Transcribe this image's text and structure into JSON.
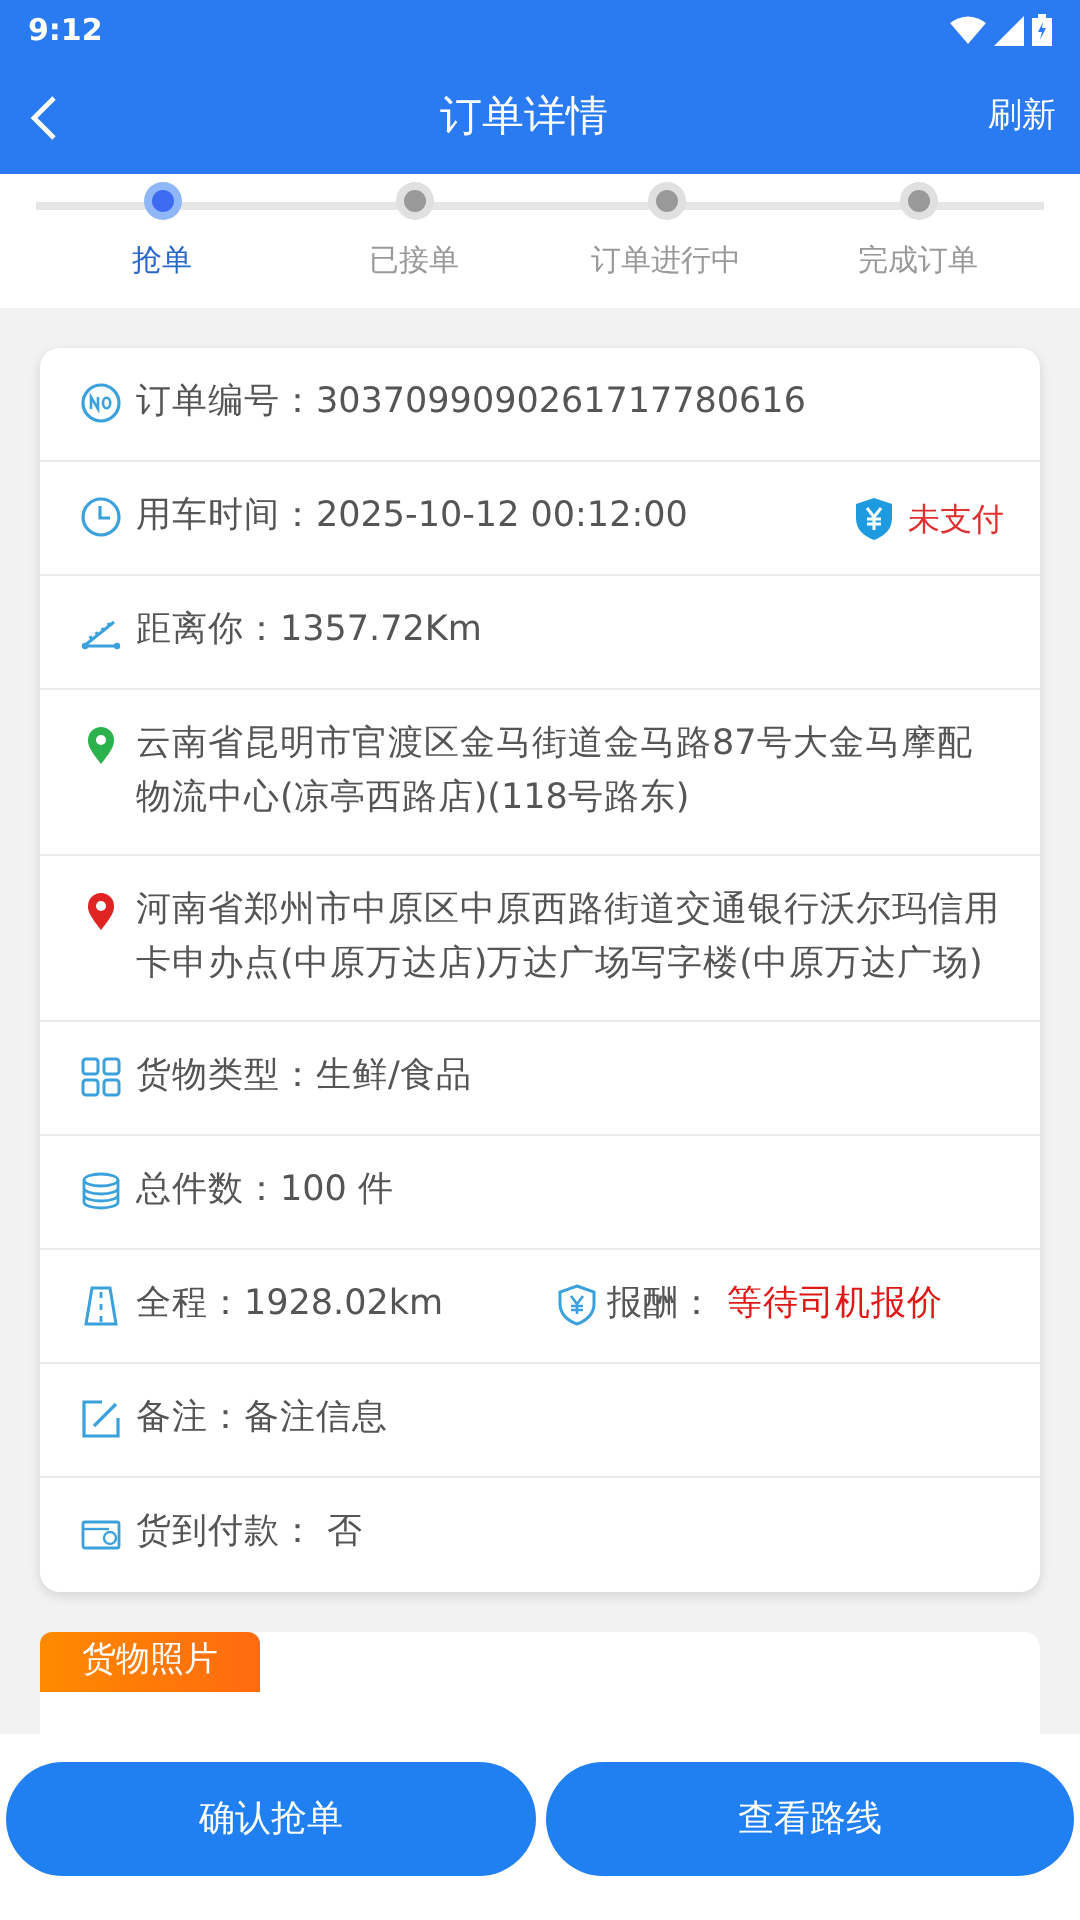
{
  "status_bar": {
    "time": "9:12"
  },
  "header": {
    "title": "订单详情",
    "action": "刷新"
  },
  "steps": [
    {
      "label": "抢单",
      "selected": true
    },
    {
      "label": "已接单",
      "selected": false
    },
    {
      "label": "订单进行中",
      "selected": false
    },
    {
      "label": "完成订单",
      "selected": false
    }
  ],
  "rows": [
    {
      "kind": "order_no",
      "text": "订单编号：3037099090261717780616"
    },
    {
      "kind": "time",
      "text": "用车时间：2025-10-12 00:12:00",
      "extra": {
        "kind": "payment",
        "value": "未支付"
      }
    },
    {
      "kind": "distance",
      "text": "距离你：1357.72Km"
    },
    {
      "kind": "origin",
      "text": "云南省昆明市官渡区金马街道金马路87号大金马摩配物流中心(凉亭西路店)(118号路东)"
    },
    {
      "kind": "destination",
      "text": "河南省郑州市中原区中原西路街道交通银行沃尔玛信用卡申办点(中原万达店)万达广场写字楼(中原万达广场)"
    },
    {
      "kind": "cargo_type",
      "text": "货物类型：生鲜/食品"
    },
    {
      "kind": "count",
      "text": "总件数：100 件"
    },
    {
      "kind": "route",
      "text": "全程：1928.02km",
      "extra": {
        "kind": "reward",
        "label": "报酬：",
        "value": "等待司机报价"
      }
    },
    {
      "kind": "remark",
      "text": "备注：备注信息"
    },
    {
      "kind": "cod",
      "text": "货到付款： 否"
    }
  ],
  "photos": {
    "title": "货物照片"
  },
  "buttons": [
    {
      "label": "确认抢单"
    },
    {
      "label": "查看路线"
    }
  ]
}
